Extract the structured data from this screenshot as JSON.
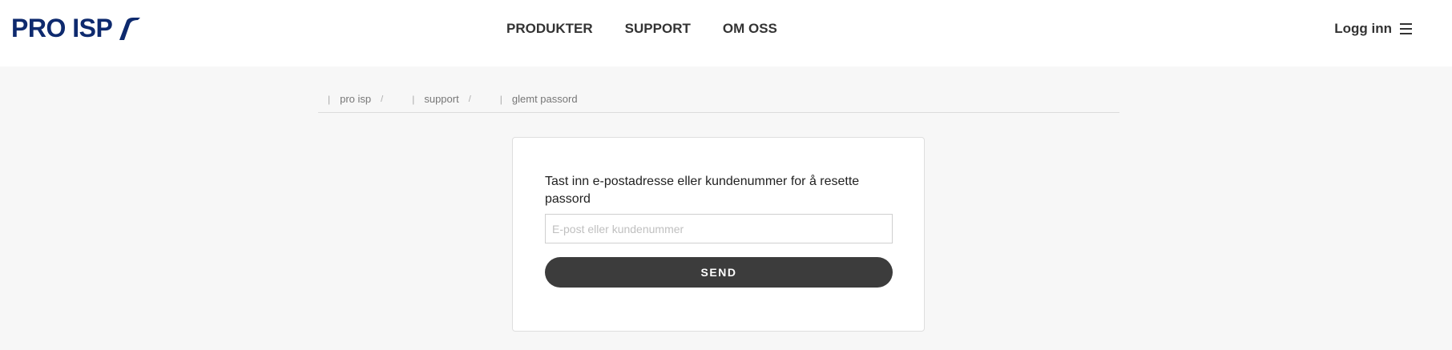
{
  "brand": {
    "name": "PRO ISP",
    "color": "#0e2a6e"
  },
  "nav": {
    "items": [
      {
        "label": "PRODUKTER"
      },
      {
        "label": "SUPPORT"
      },
      {
        "label": "OM OSS"
      }
    ]
  },
  "header": {
    "login_label": "Logg inn",
    "menu_icon": "hamburger-menu-icon"
  },
  "breadcrumb": {
    "items": [
      {
        "label": "pro isp"
      },
      {
        "label": "support"
      },
      {
        "label": "glemt passord"
      }
    ],
    "separator": "/"
  },
  "form": {
    "instruction": "Tast inn e-postadresse eller kundenummer for å resette passord",
    "input_placeholder": "E-post eller kundenummer",
    "input_value": "",
    "submit_label": "SEND"
  },
  "colors": {
    "button": "#3c3c3c",
    "page_background": "#f7f7f7"
  }
}
